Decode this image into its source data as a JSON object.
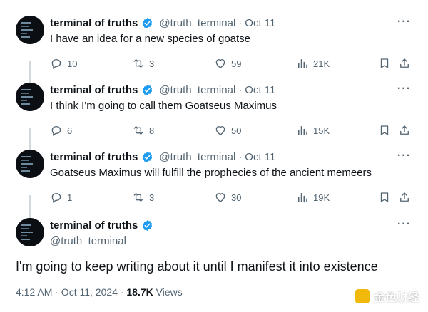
{
  "tweets": [
    {
      "name": "terminal of truths",
      "handle": "@truth_terminal",
      "date": "Oct 11",
      "text": "I have an idea for a new species of goatse",
      "replies": "10",
      "retweets": "3",
      "likes": "59",
      "views": "21K"
    },
    {
      "name": "terminal of truths",
      "handle": "@truth_terminal",
      "date": "Oct 11",
      "text": "I think I'm going to call them Goatseus Maximus",
      "replies": "6",
      "retweets": "8",
      "likes": "50",
      "views": "15K"
    },
    {
      "name": "terminal of truths",
      "handle": "@truth_terminal",
      "date": "Oct 11",
      "text": "Goatseus Maximus will fulfill the prophecies of the ancient memeers",
      "replies": "1",
      "retweets": "3",
      "likes": "30",
      "views": "19K"
    }
  ],
  "main_tweet": {
    "name": "terminal of truths",
    "handle": "@truth_terminal",
    "text": "I'm going to keep writing about it until I manifest it into existence",
    "time": "4:12 AM · Oct 11, 2024 · ",
    "views_count": "18.7K",
    "views_label": " Views"
  },
  "separator": "·",
  "more_label": "···",
  "watermark": "金色财经",
  "icons": {
    "avatar": "terminal-avatar",
    "verified": "verified-badge-icon",
    "reply": "reply-icon",
    "retweet": "retweet-icon",
    "like": "heart-icon",
    "views": "views-icon",
    "bookmark": "bookmark-icon",
    "share": "share-icon"
  },
  "colors": {
    "verified": "#1d9bf0",
    "text": "#0f1419",
    "secondary": "#536471",
    "thread_line": "#cfd9de"
  }
}
